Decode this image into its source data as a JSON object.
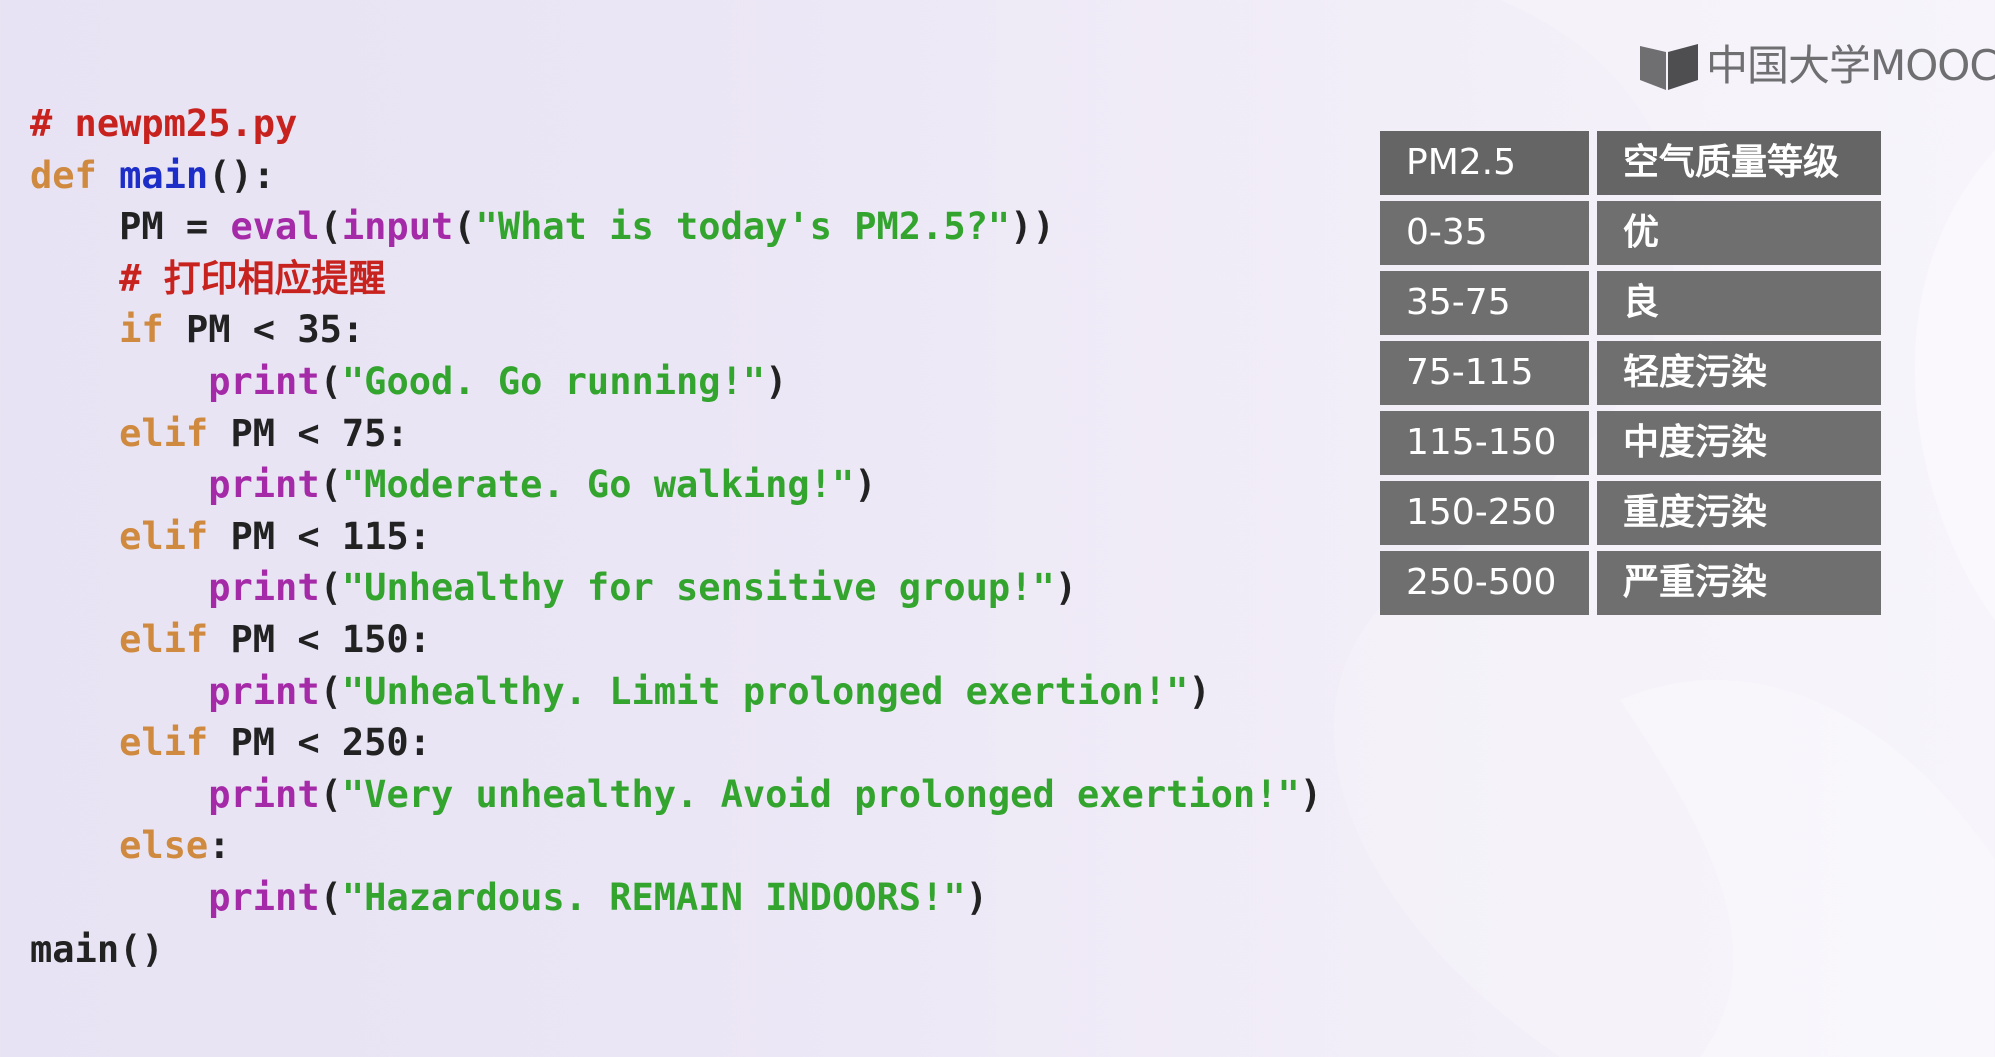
{
  "logo": {
    "text": "中国大学MOOC",
    "icon": "mooc-logo-icon"
  },
  "code": {
    "filename_comment": "# newpm25.py",
    "lines": [
      [
        {
          "t": "# newpm25.py",
          "c": "cm"
        }
      ],
      [
        {
          "t": "def ",
          "c": "kw"
        },
        {
          "t": "main",
          "c": "fn"
        },
        {
          "t": "():",
          "c": "tx"
        }
      ],
      [
        {
          "t": "    PM = ",
          "c": "tx"
        },
        {
          "t": "eval",
          "c": "bi"
        },
        {
          "t": "(",
          "c": "tx"
        },
        {
          "t": "input",
          "c": "bi"
        },
        {
          "t": "(",
          "c": "tx"
        },
        {
          "t": "\"What is today's PM2.5?\"",
          "c": "st"
        },
        {
          "t": "))",
          "c": "tx"
        }
      ],
      [
        {
          "t": "    # 打印相应提醒",
          "c": "cm"
        }
      ],
      [
        {
          "t": "    ",
          "c": "tx"
        },
        {
          "t": "if",
          "c": "kw"
        },
        {
          "t": " PM < 35:",
          "c": "tx"
        }
      ],
      [
        {
          "t": "        ",
          "c": "tx"
        },
        {
          "t": "print",
          "c": "bi"
        },
        {
          "t": "(",
          "c": "tx"
        },
        {
          "t": "\"Good. Go running!\"",
          "c": "st"
        },
        {
          "t": ")",
          "c": "tx"
        }
      ],
      [
        {
          "t": "    ",
          "c": "tx"
        },
        {
          "t": "elif",
          "c": "kw"
        },
        {
          "t": " PM < 75:",
          "c": "tx"
        }
      ],
      [
        {
          "t": "        ",
          "c": "tx"
        },
        {
          "t": "print",
          "c": "bi"
        },
        {
          "t": "(",
          "c": "tx"
        },
        {
          "t": "\"Moderate. Go walking!\"",
          "c": "st"
        },
        {
          "t": ")",
          "c": "tx"
        }
      ],
      [
        {
          "t": "    ",
          "c": "tx"
        },
        {
          "t": "elif",
          "c": "kw"
        },
        {
          "t": " PM < 115:",
          "c": "tx"
        }
      ],
      [
        {
          "t": "        ",
          "c": "tx"
        },
        {
          "t": "print",
          "c": "bi"
        },
        {
          "t": "(",
          "c": "tx"
        },
        {
          "t": "\"Unhealthy for sensitive group!\"",
          "c": "st"
        },
        {
          "t": ")",
          "c": "tx"
        }
      ],
      [
        {
          "t": "    ",
          "c": "tx"
        },
        {
          "t": "elif",
          "c": "kw"
        },
        {
          "t": " PM < 150:",
          "c": "tx"
        }
      ],
      [
        {
          "t": "        ",
          "c": "tx"
        },
        {
          "t": "print",
          "c": "bi"
        },
        {
          "t": "(",
          "c": "tx"
        },
        {
          "t": "\"Unhealthy. Limit prolonged exertion!\"",
          "c": "st"
        },
        {
          "t": ")",
          "c": "tx"
        }
      ],
      [
        {
          "t": "    ",
          "c": "tx"
        },
        {
          "t": "elif",
          "c": "kw"
        },
        {
          "t": " PM < 250:",
          "c": "tx"
        }
      ],
      [
        {
          "t": "        ",
          "c": "tx"
        },
        {
          "t": "print",
          "c": "bi"
        },
        {
          "t": "(",
          "c": "tx"
        },
        {
          "t": "\"Very unhealthy. Avoid prolonged exertion!\"",
          "c": "st"
        },
        {
          "t": ")",
          "c": "tx"
        }
      ],
      [
        {
          "t": "    ",
          "c": "tx"
        },
        {
          "t": "else",
          "c": "kw"
        },
        {
          "t": ":",
          "c": "tx"
        }
      ],
      [
        {
          "t": "        ",
          "c": "tx"
        },
        {
          "t": "print",
          "c": "bi"
        },
        {
          "t": "(",
          "c": "tx"
        },
        {
          "t": "\"Hazardous. REMAIN INDOORS!\"",
          "c": "st"
        },
        {
          "t": ")",
          "c": "tx"
        }
      ],
      [
        {
          "t": "main",
          "c": "tx"
        },
        {
          "t": "()",
          "c": "tx"
        }
      ]
    ]
  },
  "pm_table": {
    "header": [
      "PM2.5",
      "空气质量等级"
    ],
    "rows": [
      [
        "0-35",
        "优"
      ],
      [
        "35-75",
        "良"
      ],
      [
        "75-115",
        "轻度污染"
      ],
      [
        "115-150",
        "中度污染"
      ],
      [
        "150-250",
        "重度污染"
      ],
      [
        "250-500",
        "严重污染"
      ]
    ]
  },
  "colors": {
    "comment": "#c8221e",
    "keyword": "#cf8a3f",
    "function_name": "#1d2ec8",
    "builtin": "#a52aa8",
    "string": "#33a52f",
    "table_cell": "#6f6f70"
  }
}
